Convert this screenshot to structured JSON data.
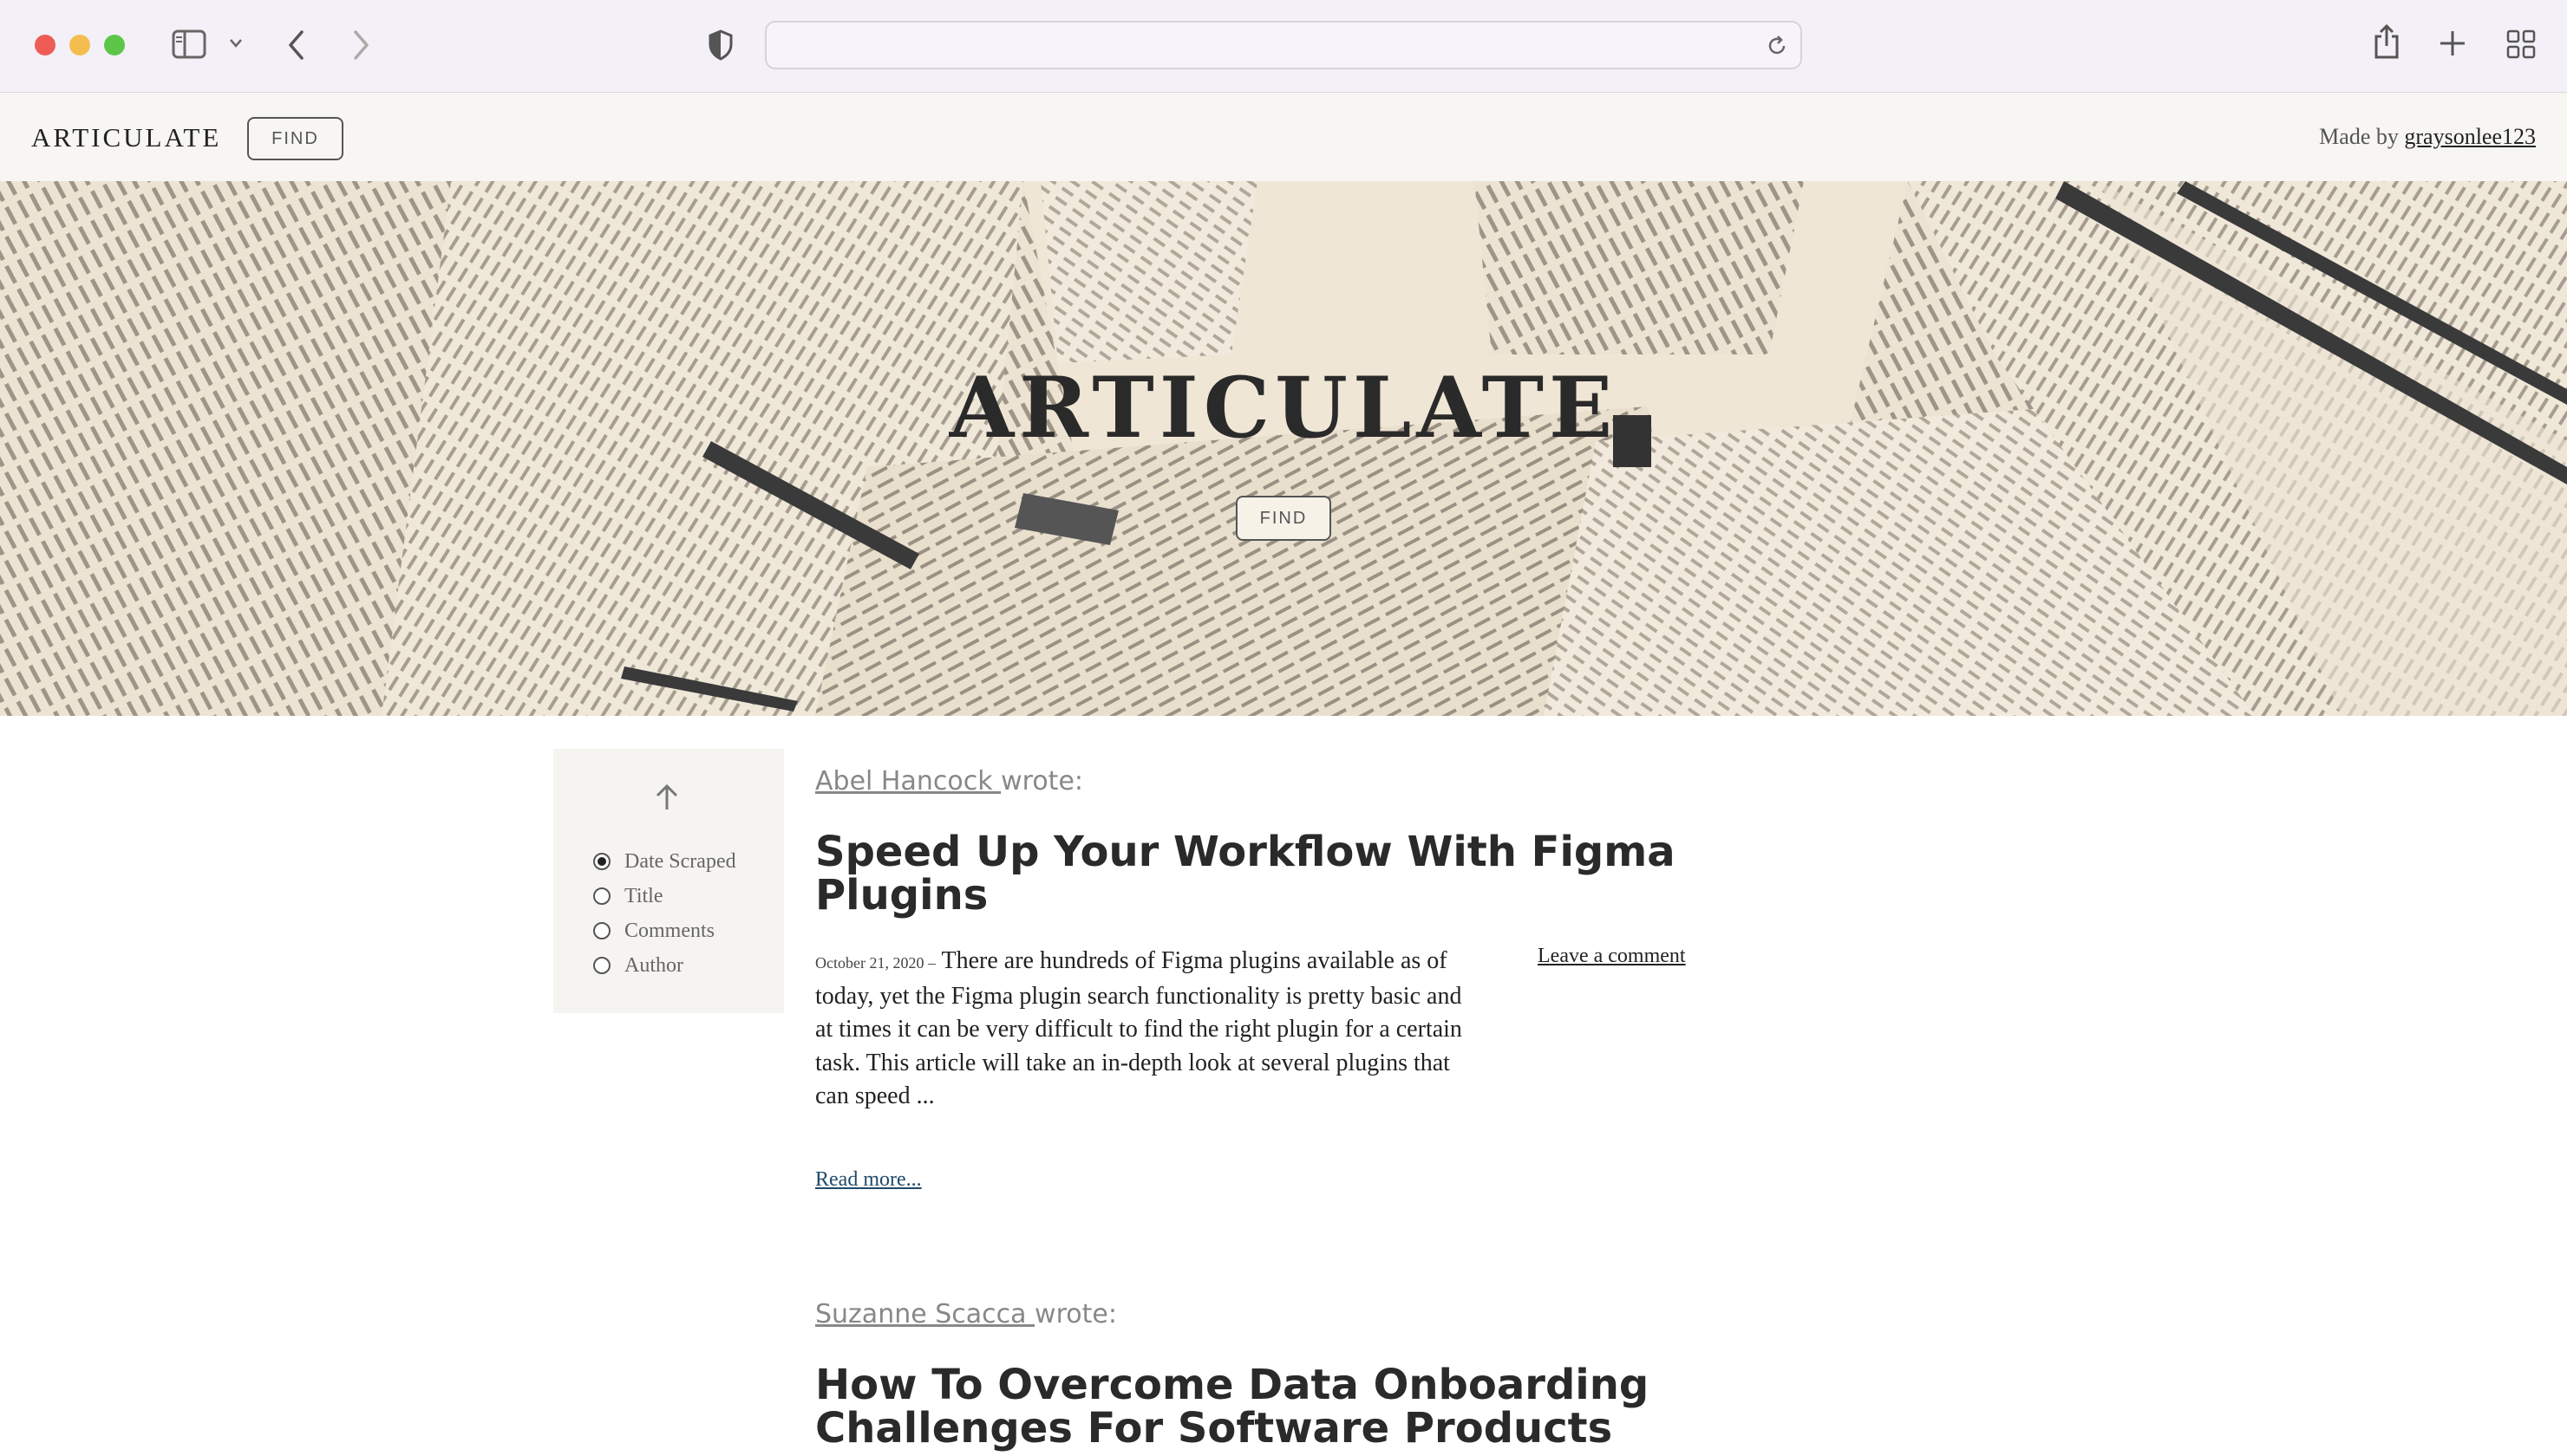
{
  "browser": {
    "address": ""
  },
  "site": {
    "brand": "ARTICULATE",
    "find_label": "FIND",
    "made_by_prefix": "Made by",
    "made_by_user": "graysonlee123"
  },
  "hero": {
    "title": "ARTICULATE",
    "find_label": "FIND"
  },
  "sort": {
    "options": [
      "Date Scraped",
      "Title",
      "Comments",
      "Author"
    ],
    "selected": "Date Scraped"
  },
  "articles": [
    {
      "author": "Abel Hancock",
      "wrote": "wrote:",
      "title": "Speed Up Your Workflow With Figma Plugins",
      "date": "October 21, 2020 –",
      "excerpt": "There are hundreds of Figma plugins available as of today, yet the Figma plugin search functionality is pretty basic and at times it can be very difficult to find the right plugin for a certain task. This article will take an in-depth look at several plugins that can speed ...",
      "read_more": "Read more...",
      "leave_comment": "Leave a comment"
    },
    {
      "author": "Suzanne Scacca",
      "wrote": "wrote:",
      "title": "How To Overcome Data Onboarding Challenges For Software Products"
    }
  ]
}
